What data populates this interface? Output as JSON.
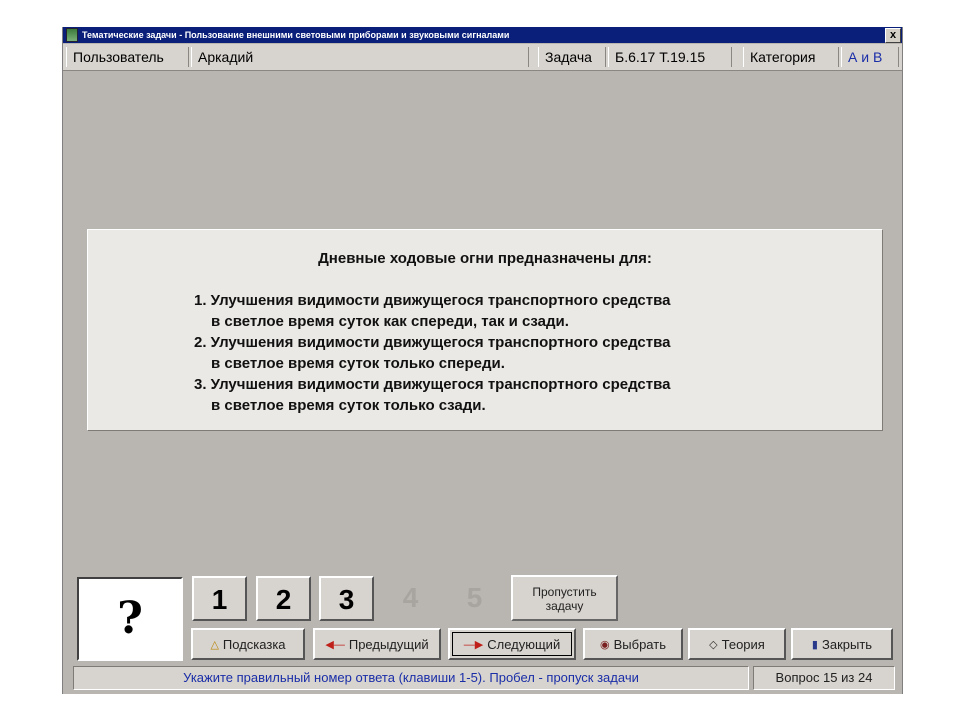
{
  "window": {
    "title": "Тематические задачи - Пользование внешними световыми приборами и звуковыми сигналами",
    "close_label": "x"
  },
  "infobar": {
    "user_label": "Пользователь",
    "user_value": "Аркадий",
    "task_label": "Задача",
    "task_value": "Б.6.17  Т.19.15",
    "category_label": "Категория",
    "category_value": "А и В",
    "category_color": "#1a2ea8"
  },
  "question": {
    "title": "Дневные ходовые огни предназначены для:",
    "answers": [
      {
        "line1": "1. Улучшения видимости движущегося транспортного средства",
        "line2": "в светлое время суток как спереди, так и сзади."
      },
      {
        "line1": "2. Улучшения видимости движущегося транспортного средства",
        "line2": "в светлое время суток только спереди."
      },
      {
        "line1": "3. Улучшения видимости движущегося транспортного средства",
        "line2": "в светлое время суток только сзади."
      }
    ]
  },
  "answer_box": {
    "symbol": "?"
  },
  "number_buttons": [
    {
      "label": "1",
      "enabled": true
    },
    {
      "label": "2",
      "enabled": true
    },
    {
      "label": "3",
      "enabled": true
    },
    {
      "label": "4",
      "enabled": false
    },
    {
      "label": "5",
      "enabled": false
    }
  ],
  "skip": {
    "line1": "Пропустить",
    "line2": "задачу"
  },
  "actions": {
    "hint": {
      "icon": "bell-icon",
      "label": "Подсказка"
    },
    "prev": {
      "icon": "arrow-left-icon",
      "label": "Предыдущий"
    },
    "next": {
      "icon": "arrow-right-icon",
      "label": "Следующий"
    },
    "select": {
      "icon": "select-icon",
      "label": "Выбрать"
    },
    "theory": {
      "icon": "diamond-icon",
      "label": "Теория"
    },
    "close": {
      "icon": "exit-icon",
      "label": "Закрыть"
    }
  },
  "status": {
    "hint_text": "Укажите правильный номер ответа (клавиши 1-5). Пробел - пропуск задачи",
    "progress": "Вопрос 15 из 24"
  }
}
